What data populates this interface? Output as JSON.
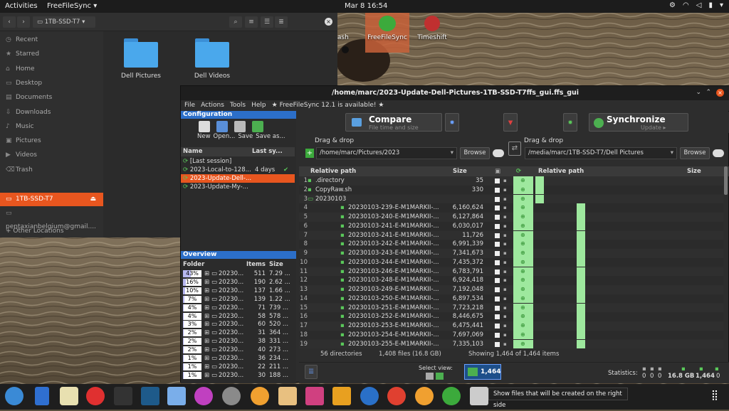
{
  "topbar": {
    "activities": "Activities",
    "app": "FreeFileSync ▾",
    "clock": "Mar 8  16:54",
    "tray": [
      "⚙ ▾",
      "◉",
      "⌔",
      "🔔",
      "▾"
    ]
  },
  "desktop_icons": [
    {
      "label": "rash"
    },
    {
      "label": "FreeFileSync"
    },
    {
      "label": "Timeshift"
    }
  ],
  "filemanager": {
    "location": "1TB-SSD-T7",
    "sidebar": [
      "Recent",
      "Starred",
      "Home",
      "Desktop",
      "Documents",
      "Downloads",
      "Music",
      "Pictures",
      "Videos",
      "Trash"
    ],
    "device": "1TB-SSD-T7",
    "account": "pentaxianbelgium@gmail....",
    "other": "+ Other Locations",
    "folders": [
      "Dell Pictures",
      "Dell Videos"
    ]
  },
  "ffs": {
    "title": "/home/marc/2023-Update-Dell-Pictures-1TB-SSD-T7ffs_gui.ffs_gui",
    "menu": [
      "File",
      "Actions",
      "Tools",
      "Help",
      "★ FreeFileSync 12.1 is available! ★"
    ],
    "config": {
      "header": "Configuration",
      "buttons": [
        "New",
        "Open...",
        "Save",
        "Save as..."
      ],
      "col_name": "Name",
      "col_last": "Last sy...",
      "rows": [
        {
          "name": "[Last session]",
          "when": ""
        },
        {
          "name": "2023-Local-to-128...",
          "when": "4 days"
        },
        {
          "name": "2023-Update-Dell-...",
          "when": ""
        },
        {
          "name": "2023-Update-My-...",
          "when": ""
        }
      ]
    },
    "compare": {
      "label": "Compare",
      "sub": "File time and size"
    },
    "sync": {
      "label": "Synchronize",
      "sub": "Update ▸"
    },
    "left": {
      "dragdrop": "Drag & drop",
      "path": "/home/marc/Pictures/2023",
      "browse": "Browse",
      "col_path": "Relative path",
      "col_size": "Size"
    },
    "right": {
      "dragdrop": "Drag & drop",
      "path": "/media/marc/1TB-SSD-T7/Dell Pictures",
      "browse": "Browse",
      "col_path": "Relative path",
      "col_size": "Size"
    },
    "rows": [
      {
        "n": "1",
        "name": ".directory",
        "size": "35",
        "folder": false,
        "indent": 0
      },
      {
        "n": "2",
        "name": "CopyRaw.sh",
        "size": "330",
        "folder": false,
        "indent": 0
      },
      {
        "n": "3",
        "name": "20230103",
        "size": "",
        "folder": true,
        "indent": 0
      },
      {
        "n": "4",
        "name": "20230103-239-E-M1MARKII-...",
        "size": "6,160,624",
        "folder": false,
        "indent": 1
      },
      {
        "n": "5",
        "name": "20230103-240-E-M1MARKII-...",
        "size": "6,127,864",
        "folder": false,
        "indent": 1
      },
      {
        "n": "6",
        "name": "20230103-241-E-M1MARKII-...",
        "size": "6,030,017",
        "folder": false,
        "indent": 1
      },
      {
        "n": "7",
        "name": "20230103-241-E-M1MARKII-...",
        "size": "11,726",
        "folder": false,
        "indent": 1
      },
      {
        "n": "8",
        "name": "20230103-242-E-M1MARKII-...",
        "size": "6,991,339",
        "folder": false,
        "indent": 1
      },
      {
        "n": "9",
        "name": "20230103-243-E-M1MARKII-...",
        "size": "7,341,673",
        "folder": false,
        "indent": 1
      },
      {
        "n": "10",
        "name": "20230103-244-E-M1MARKII-...",
        "size": "7,435,372",
        "folder": false,
        "indent": 1
      },
      {
        "n": "11",
        "name": "20230103-246-E-M1MARKII-...",
        "size": "6,783,791",
        "folder": false,
        "indent": 1
      },
      {
        "n": "12",
        "name": "20230103-248-E-M1MARKII-...",
        "size": "6,924,418",
        "folder": false,
        "indent": 1
      },
      {
        "n": "13",
        "name": "20230103-249-E-M1MARKII-...",
        "size": "7,192,048",
        "folder": false,
        "indent": 1
      },
      {
        "n": "14",
        "name": "20230103-250-E-M1MARKII-...",
        "size": "6,897,534",
        "folder": false,
        "indent": 1
      },
      {
        "n": "15",
        "name": "20230103-251-E-M1MARKII-...",
        "size": "7,723,218",
        "folder": false,
        "indent": 1
      },
      {
        "n": "16",
        "name": "20230103-252-E-M1MARKII-...",
        "size": "8,446,675",
        "folder": false,
        "indent": 1
      },
      {
        "n": "17",
        "name": "20230103-253-E-M1MARKII-...",
        "size": "6,475,441",
        "folder": false,
        "indent": 1
      },
      {
        "n": "18",
        "name": "20230103-254-E-M1MARKII-...",
        "size": "7,697,069",
        "folder": false,
        "indent": 1
      },
      {
        "n": "19",
        "name": "20230103-255-E-M1MARKII-...",
        "size": "7,335,103",
        "folder": false,
        "indent": 1
      }
    ],
    "overview": {
      "header": "Overview",
      "col_folder": "Folder",
      "col_items": "Items",
      "col_size": "Size",
      "rows": [
        {
          "pct": "43%",
          "fill": 0.43,
          "name": "20230...",
          "items": "511",
          "size": "7.29 ..."
        },
        {
          "pct": "16%",
          "fill": 0.16,
          "name": "20230...",
          "items": "190",
          "size": "2.62 ..."
        },
        {
          "pct": "10%",
          "fill": 0.1,
          "name": "20230...",
          "items": "137",
          "size": "1.66 ..."
        },
        {
          "pct": "7%",
          "fill": 0.07,
          "name": "20230...",
          "items": "139",
          "size": "1.22 ..."
        },
        {
          "pct": "4%",
          "fill": 0.04,
          "name": "20230...",
          "items": "71",
          "size": "739 ..."
        },
        {
          "pct": "4%",
          "fill": 0.04,
          "name": "20230...",
          "items": "58",
          "size": "578 ..."
        },
        {
          "pct": "3%",
          "fill": 0.03,
          "name": "20230...",
          "items": "60",
          "size": "520 ..."
        },
        {
          "pct": "2%",
          "fill": 0.02,
          "name": "20230...",
          "items": "31",
          "size": "364 ..."
        },
        {
          "pct": "2%",
          "fill": 0.02,
          "name": "20230...",
          "items": "38",
          "size": "331 ..."
        },
        {
          "pct": "2%",
          "fill": 0.02,
          "name": "20230...",
          "items": "40",
          "size": "273 ..."
        },
        {
          "pct": "1%",
          "fill": 0.01,
          "name": "20230...",
          "items": "36",
          "size": "234 ..."
        },
        {
          "pct": "1%",
          "fill": 0.01,
          "name": "20230...",
          "items": "22",
          "size": "211 ..."
        },
        {
          "pct": "1%",
          "fill": 0.01,
          "name": "20230...",
          "items": "30",
          "size": "188 ..."
        }
      ]
    },
    "status": {
      "dirs": "56 directories",
      "files": "1,408 files (16.8 GB)",
      "showing": "Showing 1,464 of 1,464 items"
    },
    "bottom": {
      "select_view": "Select view:",
      "count": "1,464",
      "statistics": "Statistics:",
      "stats": [
        "0",
        "0",
        "0",
        "16.8 GB",
        "1,464",
        "0"
      ]
    }
  },
  "tooltip": "Show files that will be created on the right side",
  "colors": {
    "accent": "#e8561f",
    "blue": "#2c6fc9",
    "green": "#9ee89e"
  }
}
